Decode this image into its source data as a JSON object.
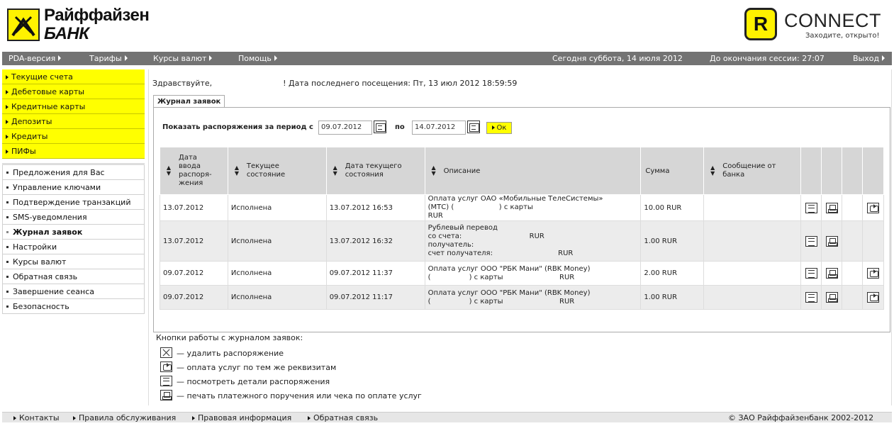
{
  "bank": {
    "name_line1": "Райффайзен",
    "name_line2": "БАНК"
  },
  "connect": {
    "letter": "R",
    "name": "CONNECT",
    "slogan": "Заходите, открыто!"
  },
  "topnav": {
    "pda": "PDA-версия",
    "tariffs": "Тарифы",
    "rates": "Курсы валют",
    "help": "Помощь",
    "today": "Сегодня суббота, 14 июля 2012",
    "session": "До окончания сессии: 27:07",
    "exit": "Выход"
  },
  "sidebar": {
    "primary": [
      "Текущие счета",
      "Дебетовые карты",
      "Кредитные карты",
      "Депозиты",
      "Кредиты",
      "ПИФы"
    ],
    "secondary": [
      "Предложения для Вас",
      "Управление ключами",
      "Подтверждение транзакций",
      "SMS-уведомления",
      "Журнал заявок",
      "Настройки",
      "Курсы валют",
      "Обратная связь",
      "Завершение сеанса",
      "Безопасность"
    ]
  },
  "greeting": {
    "hello": "Здравствуйте,",
    "last_visit": "! Дата последнего посещения: Пт, 13 июл 2012 18:59:59"
  },
  "tab": {
    "label": "Журнал заявок"
  },
  "filter": {
    "label": "Показать распоряжения за период с",
    "from": "09.07.2012",
    "to_label": "по",
    "to": "14.07.2012",
    "ok": "Ок"
  },
  "table": {
    "headers": {
      "entry_date": "Дата ввода распоря-жения",
      "state": "Текущее состояние",
      "state_date": "Дата текущего состояния",
      "description": "Описание",
      "amount": "Сумма",
      "message": "Сообщение от банка"
    },
    "rows": [
      {
        "entry_date": "13.07.2012",
        "state": "Исполнена",
        "state_date": "13.07.2012 16:53",
        "desc": [
          "Оплата услуг ОАО «Мобильные ТелеСистемы»",
          "(МТС) (                    ) с карты",
          "RUR"
        ],
        "amount": "10.00 RUR"
      },
      {
        "entry_date": "13.07.2012",
        "state": "Исполнена",
        "state_date": "13.07.2012 16:32",
        "desc": [
          "Рублевый перевод",
          "со счета:                              RUR",
          "получатель:",
          "счет получателя:                             RUR"
        ],
        "amount": "1.00 RUR"
      },
      {
        "entry_date": "09.07.2012",
        "state": "Исполнена",
        "state_date": "09.07.2012 11:37",
        "desc": [
          "Оплата услуг ООО \"РБК Мани\" (RBK Money)",
          "(                 ) с карты                         RUR"
        ],
        "amount": "2.00 RUR"
      },
      {
        "entry_date": "09.07.2012",
        "state": "Исполнена",
        "state_date": "09.07.2012 11:17",
        "desc": [
          "Оплата услуг ООО \"РБК Мани\" (RBK Money)",
          "(                 ) с карты                         RUR"
        ],
        "amount": "1.00 RUR"
      }
    ]
  },
  "legend": {
    "title": "Кнопки работы с журналом заявок:",
    "delete": "— удалить распоряжение",
    "repeat": "— оплата услуг по тем же реквизитам",
    "details": "— посмотреть детали распоряжения",
    "print": "— печать платежного поручения или чека по оплате услуг"
  },
  "footer": {
    "contacts": "Контакты",
    "rules": "Правила обслуживания",
    "legal": "Правовая информация",
    "feedback": "Обратная связь",
    "copyright": "© ЗАО Райффайзенбанк 2002-2012"
  }
}
